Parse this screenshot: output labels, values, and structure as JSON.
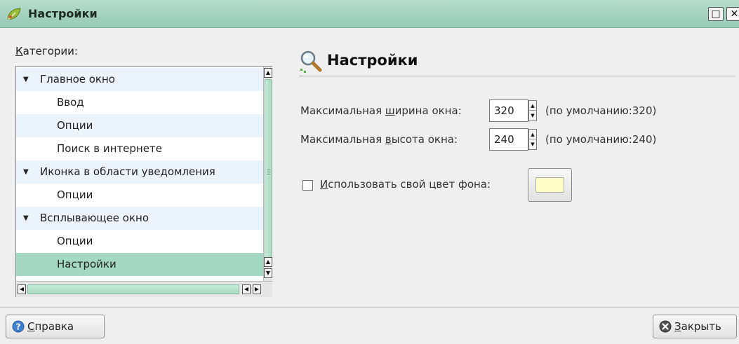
{
  "window": {
    "title": "Настройки",
    "maximize_glyph": "□",
    "close_glyph": "✕"
  },
  "sidebar": {
    "label_mnemonic": "К",
    "label_rest": "атегории:",
    "items": [
      {
        "label": "Главное окно",
        "expanded": true,
        "level": 0
      },
      {
        "label": "Ввод",
        "level": 1
      },
      {
        "label": "Опции",
        "level": 1
      },
      {
        "label": "Поиск в интернете",
        "level": 1
      },
      {
        "label": "Иконка в области уведомления",
        "expanded": true,
        "level": 0
      },
      {
        "label": "Опции",
        "level": 1
      },
      {
        "label": "Всплывающее окно",
        "expanded": true,
        "level": 0
      },
      {
        "label": "Опции",
        "level": 1
      },
      {
        "label": "Настройки",
        "level": 1,
        "selected": true
      }
    ]
  },
  "main": {
    "section_title": "Настройки",
    "width": {
      "label_pre": "Максимальная ",
      "label_mnemonic": "ш",
      "label_post": "ирина окна:",
      "value": "320",
      "default_note": "(по умолчанию:320)"
    },
    "height": {
      "label_pre": "Максимальная ",
      "label_mnemonic": "в",
      "label_post": "ысота окна:",
      "value": "240",
      "default_note": "(по умолчанию:240)"
    },
    "custom_bg": {
      "checked": false,
      "label_mnemonic": "И",
      "label_rest": "спользовать свой цвет фона:",
      "color": "#ffffc8"
    }
  },
  "footer": {
    "help_mnemonic": "С",
    "help_rest": "правка",
    "close_mnemonic": "З",
    "close_rest": "акрыть"
  },
  "colors": {
    "accent": "#98c9b6",
    "selection": "#a5d8c4",
    "alt_row": "#ebf3fb"
  }
}
